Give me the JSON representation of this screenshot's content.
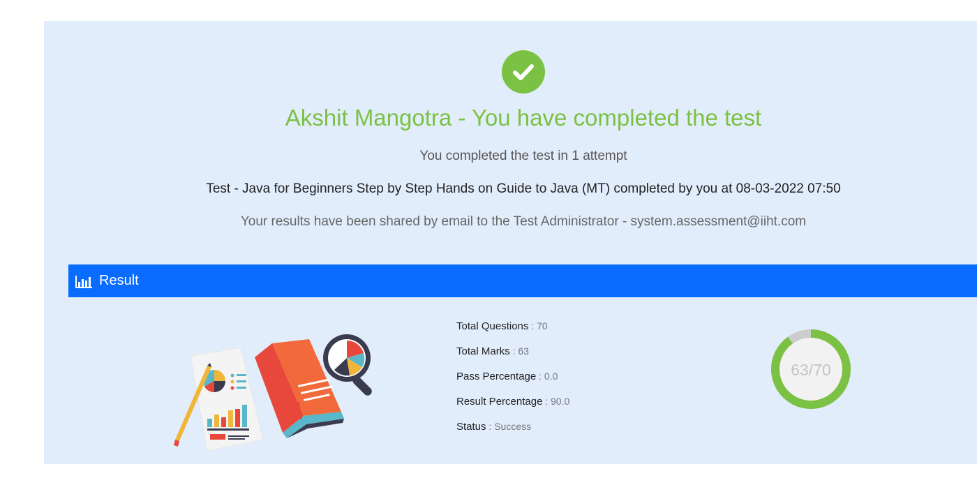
{
  "header": {
    "headline": "Akshit Mangotra - You have completed the test",
    "attempts_text": "You completed the test in 1 attempt",
    "test_completion_text": "Test - Java for Beginners Step by Step Hands on Guide to Java (MT) completed by you at 08-03-2022 07:50",
    "shared_text": "Your results have been shared by email to the Test Administrator - system.assessment@iiht.com"
  },
  "result_section": {
    "title": "Result",
    "icon": "bar-chart-icon",
    "stats": [
      {
        "label": "Total Questions",
        "value": "70"
      },
      {
        "label": "Total Marks",
        "value": "63"
      },
      {
        "label": "Pass Percentage",
        "value": "0.0"
      },
      {
        "label": "Result Percentage",
        "value": "90.0"
      },
      {
        "label": "Status",
        "value": "Success"
      }
    ],
    "score": {
      "text": "63/70",
      "obtained": 63,
      "total": 70
    }
  },
  "colors": {
    "success_green": "#7bc143",
    "panel_background": "#e2edfc",
    "result_bar_blue": "#0a6cff",
    "ring_track": "#cccccc"
  }
}
